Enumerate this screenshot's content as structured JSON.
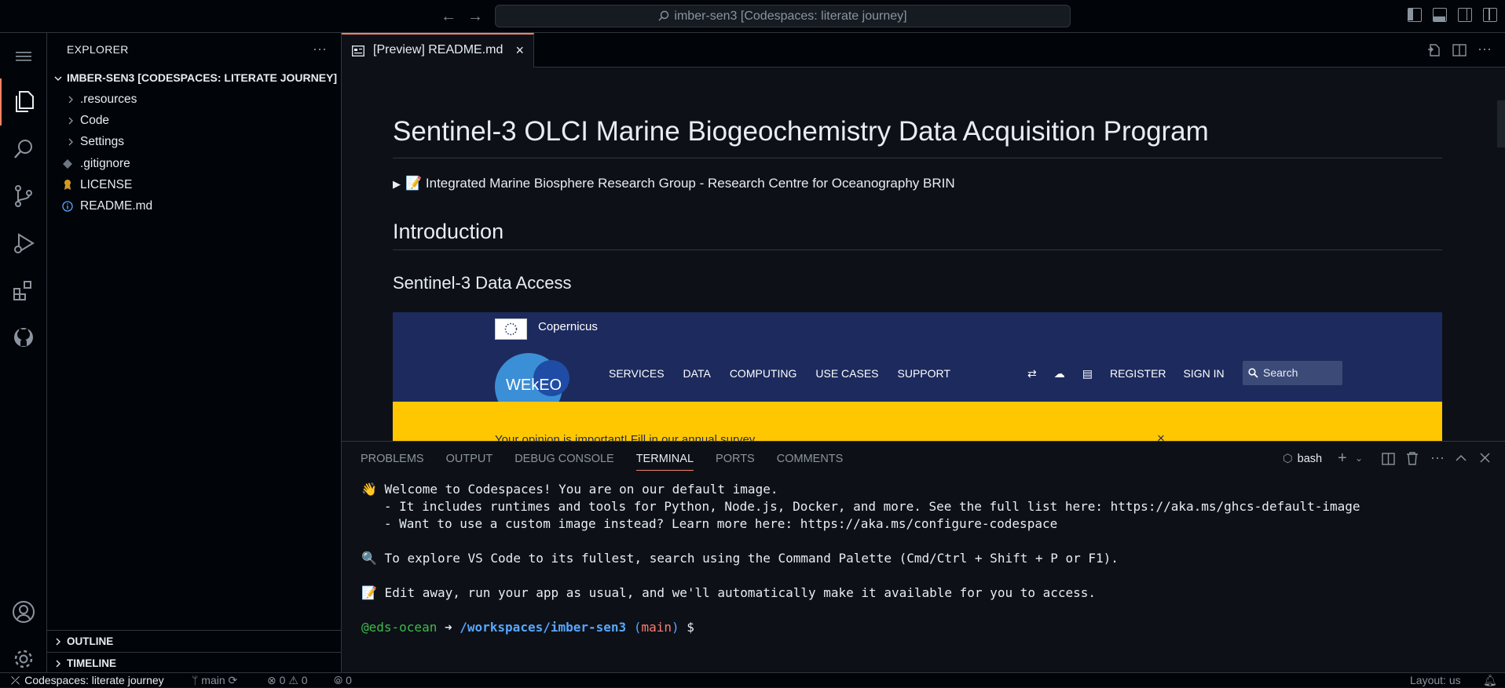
{
  "titlebar": {
    "command_center": "imber-sen3 [Codespaces: literate journey]"
  },
  "sidebar": {
    "title": "EXPLORER",
    "root": "IMBER-SEN3 [CODESPACES: LITERATE JOURNEY]",
    "items": [
      {
        "label": ".resources",
        "type": "folder"
      },
      {
        "label": "Code",
        "type": "folder"
      },
      {
        "label": "Settings",
        "type": "folder"
      },
      {
        "label": ".gitignore",
        "type": "file"
      },
      {
        "label": "LICENSE",
        "type": "file"
      },
      {
        "label": "README.md",
        "type": "file"
      }
    ],
    "outline": "OUTLINE",
    "timeline": "TIMELINE"
  },
  "editor": {
    "tab_label": "[Preview] README.md",
    "h1": "Sentinel-3 OLCI Marine Biogeochemistry Data Acquisition Program",
    "details": "📝 Integrated Marine Biosphere Research Group - Research Centre for Oceanography BRIN",
    "h2": "Introduction",
    "h3": "Sentinel-3 Data Access",
    "wekeo": {
      "logo_text": "WEkEO",
      "copernicus": "Copernicus",
      "nav": [
        "SERVICES",
        "DATA",
        "COMPUTING",
        "USE CASES",
        "SUPPORT"
      ],
      "register": "REGISTER",
      "signin": "SIGN IN",
      "search_placeholder": "Search",
      "banner_text": "Your opinion is important! Fill in ",
      "banner_link": "our annual survey",
      "banner_end": ".",
      "banner_close": "×"
    }
  },
  "panel": {
    "tabs": [
      "PROBLEMS",
      "OUTPUT",
      "DEBUG CONSOLE",
      "TERMINAL",
      "PORTS",
      "COMMENTS"
    ],
    "active_tab": "TERMINAL",
    "shell": "bash",
    "terminal": {
      "line1": "👋 Welcome to Codespaces! You are on our default image.",
      "line2": "   - It includes runtimes and tools for Python, Node.js, Docker, and more. See the full list here: https://aka.ms/ghcs-default-image",
      "line3": "   - Want to use a custom image instead? Learn more here: https://aka.ms/configure-codespace",
      "line4": "🔍 To explore VS Code to its fullest, search using the Command Palette (Cmd/Ctrl + Shift + P or F1).",
      "line5": "📝 Edit away, run your app as usual, and we'll automatically make it available for you to access.",
      "prompt_user": "@eds-ocean",
      "prompt_arrow": "➜",
      "prompt_path": "/workspaces/imber-sen3",
      "prompt_branch_open": "(",
      "prompt_branch": "main",
      "prompt_branch_close": ")",
      "prompt_symbol": "$"
    }
  },
  "statusbar": {
    "remote": "Codespaces: literate journey",
    "branch": "main",
    "errors": "0",
    "warnings": "0",
    "ports": "0",
    "layout": "Layout: us"
  },
  "colors": {
    "accent": "#f78166",
    "bg": "#0d1117",
    "banner": "#ffc700",
    "wekeo_bg": "#1d2a5d"
  }
}
